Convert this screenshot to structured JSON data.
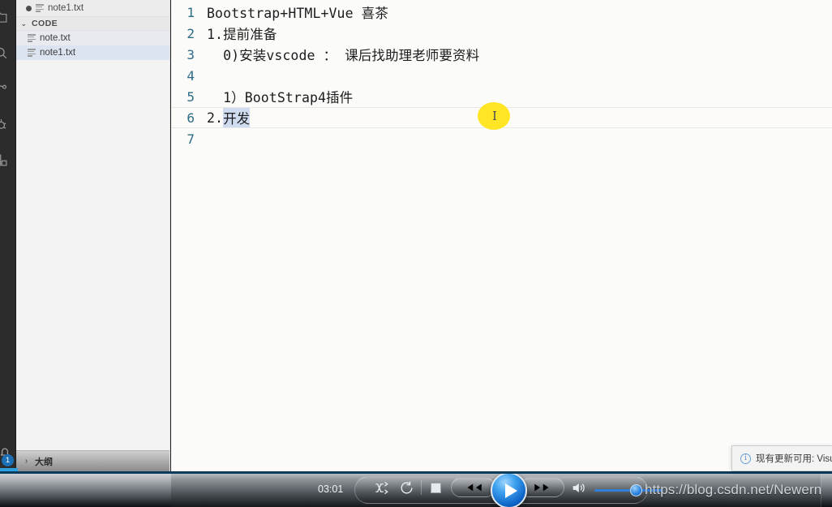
{
  "window": {
    "app": "Visual Studio Code",
    "theme_accent": "#1a6fb5",
    "editor_bg": "#fbfbfa",
    "sidebar_bg": "#f3f3f3"
  },
  "activity_bar": {
    "badge_count": "1",
    "icons": [
      {
        "name": "explorer-files-icon"
      },
      {
        "name": "search-icon"
      },
      {
        "name": "source-control-icon"
      },
      {
        "name": "run-debug-icon"
      },
      {
        "name": "extensions-icon"
      }
    ],
    "bell_icon": "bell-icon"
  },
  "editor_tab": {
    "label": "note1.txt",
    "dirty": true,
    "icon": "text-file-icon"
  },
  "explorer": {
    "section_title": "CODE",
    "twisty": "⌄",
    "items": [
      {
        "label": "note.txt",
        "icon": "text-file-icon",
        "state": "hover"
      },
      {
        "label": "note1.txt",
        "icon": "text-file-icon",
        "state": "selected"
      }
    ],
    "outline": {
      "label": "大纲",
      "twisty": "›"
    }
  },
  "code": {
    "lines": [
      {
        "num": "1",
        "text": "Bootstrap+HTML+Vue 喜茶",
        "current": false
      },
      {
        "num": "2",
        "text": "1.提前准备",
        "current": false
      },
      {
        "num": "3",
        "text": "  0)安装vscode ： 课后找助理老师要资料",
        "current": false
      },
      {
        "num": "4",
        "text": "",
        "current": false
      },
      {
        "num": "5",
        "text": "  1）BootStrap4插件",
        "current": false
      },
      {
        "num": "6",
        "text": "2.",
        "selected_text": "开发",
        "current": true
      },
      {
        "num": "7",
        "text": "",
        "current": false
      }
    ]
  },
  "cursor": {
    "glyph": "I",
    "highlight_color": "#ffe524"
  },
  "notification": {
    "icon": "info-circle-icon",
    "text": "现有更新可用: Visua"
  },
  "player": {
    "time": "03:01",
    "controls": [
      {
        "name": "shuffle-button",
        "label": "shuffle-icon"
      },
      {
        "name": "repeat-button",
        "label": "repeat-icon"
      },
      {
        "name": "stop-button",
        "label": "stop-icon"
      },
      {
        "name": "rewind-button",
        "label": "rewind-icon"
      },
      {
        "name": "play-button",
        "label": "play-icon"
      },
      {
        "name": "fast-forward-button",
        "label": "fast-forward-icon"
      },
      {
        "name": "volume-button",
        "label": "speaker-icon"
      }
    ],
    "watermark": "https://blog.csdn.net/Newernini",
    "volume_fill_color": "#2f7fd8"
  }
}
